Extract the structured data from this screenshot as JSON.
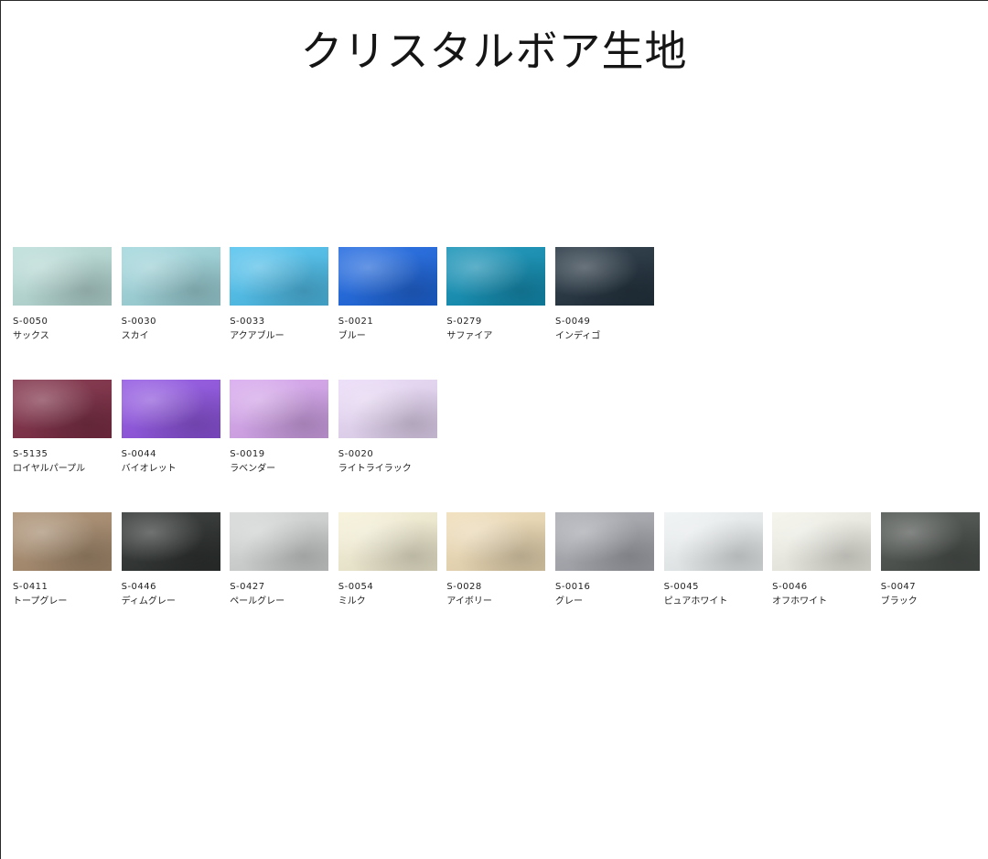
{
  "page": {
    "title": "クリスタルボア生地"
  },
  "rows": [
    {
      "swatches": [
        {
          "code": "S-0050",
          "name": "サックス",
          "color": "#b9ddd8"
        },
        {
          "code": "S-0030",
          "name": "スカイ",
          "color": "#9fd6dc"
        },
        {
          "code": "S-0033",
          "name": "アクアブルー",
          "color": "#4ec1ee"
        },
        {
          "code": "S-0021",
          "name": "ブルー",
          "color": "#1d67e0"
        },
        {
          "code": "S-0279",
          "name": "サファイア",
          "color": "#1190b6"
        },
        {
          "code": "S-0049",
          "name": "インディゴ",
          "color": "#22323f"
        }
      ]
    },
    {
      "swatches": [
        {
          "code": "S-5135",
          "name": "ロイヤルパープル",
          "color": "#7e2d45"
        },
        {
          "code": "S-0044",
          "name": "バイオレット",
          "color": "#9054e2"
        },
        {
          "code": "S-0019",
          "name": "ラベンダー",
          "color": "#d7a6ee"
        },
        {
          "code": "S-0020",
          "name": "ライトライラック",
          "color": "#eadaf8"
        }
      ]
    },
    {
      "swatches": [
        {
          "code": "S-0411",
          "name": "トープグレー",
          "color": "#a98d6f"
        },
        {
          "code": "S-0446",
          "name": "ディムグレー",
          "color": "#2c302e"
        },
        {
          "code": "S-0427",
          "name": "ペールグレー",
          "color": "#d4d6d6"
        },
        {
          "code": "S-0054",
          "name": "ミルク",
          "color": "#f6f1d6"
        },
        {
          "code": "S-0028",
          "name": "アイボリー",
          "color": "#f0ddb7"
        },
        {
          "code": "S-0016",
          "name": "グレー",
          "color": "#a7a9b0"
        },
        {
          "code": "S-0045",
          "name": "ピュアホワイト",
          "color": "#eef2f3"
        },
        {
          "code": "S-0046",
          "name": "オフホワイト",
          "color": "#f3f3ea"
        },
        {
          "code": "S-0047",
          "name": "ブラック",
          "color": "#4a4f4b"
        }
      ]
    }
  ]
}
